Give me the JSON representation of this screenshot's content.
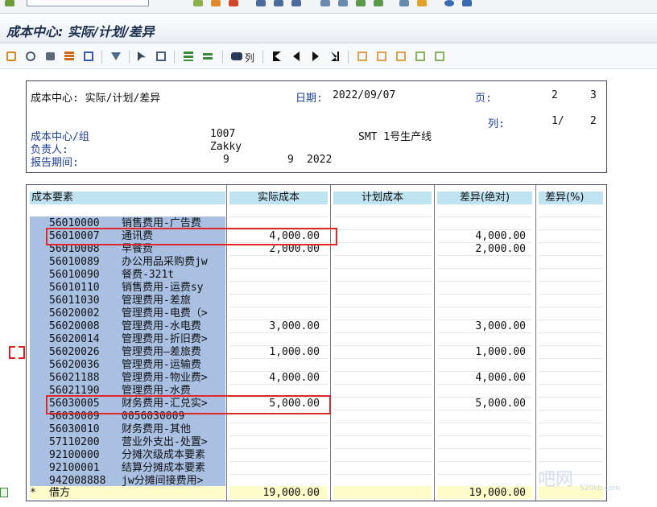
{
  "window": {
    "title": "成本中心: 实际/计划/差异"
  },
  "toolbar": {
    "columns_label": "列"
  },
  "report_header": {
    "title": "成本中心: 实际/计划/差异",
    "date_label": "日期:",
    "date_value": "2022/09/07",
    "page_label": "页:",
    "page_current": "2",
    "page_total": "3",
    "column_label": "列:",
    "column_value": "1/",
    "column_total": "2",
    "cost_center_label": "成本中心/组",
    "cost_center_id": "1007",
    "cost_center_name": "SMT 1号生产线",
    "responsible_label": "负责人:",
    "responsible_value": "Zakky",
    "period_label": "报告期间:",
    "period_from": "9",
    "period_to": "9",
    "period_year": "2022"
  },
  "table": {
    "headers": [
      "成本要素",
      "实际成本",
      "计划成本",
      "差异(绝对)",
      "差异(%)"
    ],
    "rows": [
      {
        "code": "56010000",
        "name": "销售费用-广告费",
        "actual": "",
        "variance": ""
      },
      {
        "code": "56010007",
        "name": "通讯费",
        "actual": "4,000.00",
        "variance": "4,000.00"
      },
      {
        "code": "56010008",
        "name": "早餐费",
        "actual": "2,000.00",
        "variance": "2,000.00"
      },
      {
        "code": "56010089",
        "name": "办公用品采购费jw",
        "actual": "",
        "variance": ""
      },
      {
        "code": "56010090",
        "name": "餐费-321t",
        "actual": "",
        "variance": ""
      },
      {
        "code": "56010110",
        "name": "销售费用-运费sy",
        "actual": "",
        "variance": ""
      },
      {
        "code": "56011030",
        "name": "管理费用-差旅",
        "actual": "",
        "variance": ""
      },
      {
        "code": "56020002",
        "name": "管理费用-电费（>",
        "actual": "",
        "variance": ""
      },
      {
        "code": "56020008",
        "name": "管理费用-水电费",
        "actual": "3,000.00",
        "variance": "3,000.00"
      },
      {
        "code": "56020014",
        "name": "管理费用-折旧费>",
        "actual": "",
        "variance": ""
      },
      {
        "code": "56020026",
        "name": "管理费用—差旅费",
        "actual": "1,000.00",
        "variance": "1,000.00"
      },
      {
        "code": "56020036",
        "name": "管理费用-运输费",
        "actual": "",
        "variance": ""
      },
      {
        "code": "56021188",
        "name": "管理费用-物业费>",
        "actual": "4,000.00",
        "variance": "4,000.00"
      },
      {
        "code": "56021190",
        "name": "管理费用-水费",
        "actual": "",
        "variance": ""
      },
      {
        "code": "56030005",
        "name": "财务费用-汇兑实>",
        "actual": "5,000.00",
        "variance": "5,000.00"
      },
      {
        "code": "56030009",
        "name": "0056030009",
        "actual": "",
        "variance": ""
      },
      {
        "code": "56030010",
        "name": "财务费用-其他",
        "actual": "",
        "variance": ""
      },
      {
        "code": "57110200",
        "name": "营业外支出-处置>",
        "actual": "",
        "variance": ""
      },
      {
        "code": "92100000",
        "name": "分摊次级成本要素",
        "actual": "",
        "variance": ""
      },
      {
        "code": "92100001",
        "name": "结算分摊成本要素",
        "actual": "",
        "variance": ""
      },
      {
        "code": "942008888",
        "name": "jw分摊间接费用>",
        "actual": "",
        "variance": ""
      }
    ],
    "total": {
      "marker": "*",
      "label": "借方",
      "actual": "19,000.00",
      "variance": "19,000.00"
    }
  },
  "watermark": {
    "text": "吧网",
    "sub": "520kb.com"
  },
  "colors": {
    "header_fill": "#bfe3f0",
    "cost_element_fill": "#a9c0e3",
    "total_fill": "#fefcc8",
    "highlight_box": "#e0282a",
    "label_blue": "#1a3f96"
  }
}
